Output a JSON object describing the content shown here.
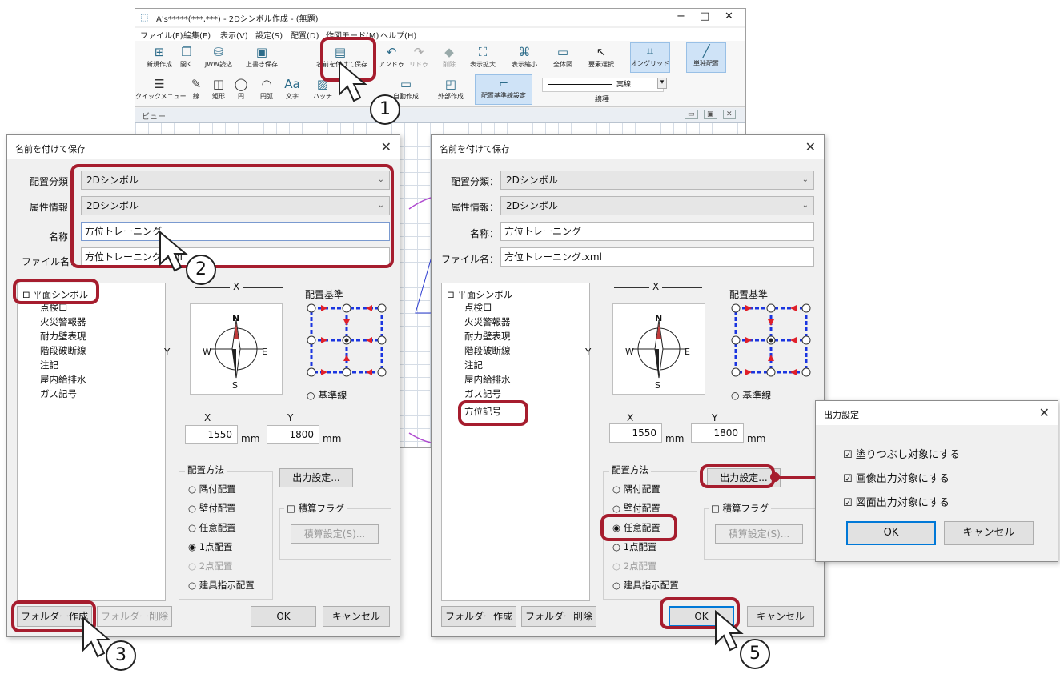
{
  "app": {
    "title": "A's*****(***,***) - 2Dシンボル作成 - (無題)",
    "window_controls": [
      "−",
      "□",
      "✕"
    ],
    "menu": [
      "ファイル(F)",
      "編集(E)",
      "表示(V)",
      "設定(S)",
      "配置(D)",
      "作図モード(M)",
      "ヘルプ(H)"
    ],
    "toolbar_row1": [
      {
        "label": "新規作成",
        "icon": "new-file-icon"
      },
      {
        "label": "開く",
        "icon": "open-folder-icon"
      },
      {
        "label": "JWW読込",
        "icon": "jww-import-icon"
      },
      {
        "label": "上書き保存",
        "icon": "save-icon"
      },
      {
        "label": "名前を付けて保存",
        "icon": "save-as-icon"
      },
      {
        "label": "アンドゥ",
        "icon": "undo-icon"
      },
      {
        "label": "リドゥ",
        "icon": "redo-icon"
      },
      {
        "label": "削除",
        "icon": "delete-icon"
      },
      {
        "label": "表示拡大",
        "icon": "zoom-in-icon"
      },
      {
        "label": "表示縮小",
        "icon": "zoom-out-icon"
      },
      {
        "label": "全体図",
        "icon": "fit-all-icon"
      },
      {
        "label": "要素選択",
        "icon": "select-arrow-icon"
      },
      {
        "label": "オングリッド",
        "icon": "on-grid-icon"
      },
      {
        "label": "単独配置",
        "icon": "single-place-icon"
      }
    ],
    "toolbar_row2": [
      {
        "label": "クイックメニュー",
        "icon": "menu-icon"
      },
      {
        "label": "線",
        "icon": "line-icon"
      },
      {
        "label": "矩形",
        "icon": "rect-icon"
      },
      {
        "label": "円",
        "icon": "circle-icon"
      },
      {
        "label": "円弧",
        "icon": "arc-icon"
      },
      {
        "label": "文字",
        "icon": "text-icon"
      },
      {
        "label": "ハッチ",
        "icon": "hatch-icon"
      },
      {
        "label": "自動作成",
        "icon": "auto-create-icon"
      },
      {
        "label": "外部作成",
        "icon": "external-create-icon"
      },
      {
        "label": "配置基準線設定",
        "icon": "base-line-icon"
      }
    ],
    "line_type_value": "実線",
    "line_type_label": "線種",
    "view_title": "ビュー"
  },
  "dialog1": {
    "title": "名前を付けて保存",
    "category_label": "配置分類：",
    "category_value": "2Dシンボル",
    "attr_label": "属性情報：",
    "attr_value": "2Dシンボル",
    "name_label": "名称：",
    "name_value": "方位トレーニング",
    "file_label": "ファイル名：",
    "file_value": "方位トレーニング.xml",
    "tree": [
      "平面シンボル",
      "点検口",
      "火災警報器",
      "耐力壁表現",
      "階段破断線",
      "注記",
      "屋内給排水",
      "ガス記号"
    ],
    "x_label": "X",
    "y_label": "Y",
    "base_group": "配置基準",
    "base_line": "○ 基準線",
    "x_value": "1550",
    "y_value": "1800",
    "unit": "mm",
    "method_group": "配置方法",
    "methods": [
      "○ 隅付配置",
      "○ 壁付配置",
      "○ 任意配置",
      "◉ 1点配置",
      "○ 2点配置",
      "○ 建具指示配置"
    ],
    "output_button": "出力設定...",
    "sum_flag": "□ 積算フラグ",
    "sum_button": "積算設定(S)...",
    "folder_create": "フォルダー作成",
    "folder_delete": "フォルダー削除",
    "ok": "OK",
    "cancel": "キャンセル"
  },
  "dialog2": {
    "title": "名前を付けて保存",
    "category_label": "配置分類：",
    "category_value": "2Dシンボル",
    "attr_label": "属性情報：",
    "attr_value": "2Dシンボル",
    "name_label": "名称：",
    "name_value": "方位トレーニング",
    "file_label": "ファイル名：",
    "file_value": "方位トレーニング.xml",
    "tree": [
      "平面シンボル",
      "点検口",
      "火災警報器",
      "耐力壁表現",
      "階段破断線",
      "注記",
      "屋内給排水",
      "ガス記号",
      "方位記号"
    ],
    "x_label": "X",
    "y_label": "Y",
    "base_group": "配置基準",
    "base_line": "○ 基準線",
    "x_value": "1550",
    "y_value": "1800",
    "unit": "mm",
    "method_group": "配置方法",
    "methods": [
      "○ 隅付配置",
      "○ 壁付配置",
      "◉ 任意配置",
      "○ 1点配置",
      "○ 2点配置",
      "○ 建具指示配置"
    ],
    "output_button": "出力設定...",
    "sum_flag": "□ 積算フラグ",
    "sum_button": "積算設定(S)...",
    "folder_create": "フォルダー作成",
    "folder_delete": "フォルダー削除",
    "ok": "OK",
    "cancel": "キャンセル"
  },
  "output_dialog": {
    "title": "出力設定",
    "options": [
      "☑ 塗りつぶし対象にする",
      "☑ 画像出力対象にする",
      "☑ 図面出力対象にする"
    ],
    "ok": "OK",
    "cancel": "キャンセル"
  },
  "steps": [
    "1",
    "2",
    "3",
    "5"
  ],
  "compass": {
    "n": "N",
    "s": "S",
    "e": "E",
    "w": "W"
  },
  "colors": {
    "highlight": "#a61d2e",
    "accent": "#0078d7"
  }
}
